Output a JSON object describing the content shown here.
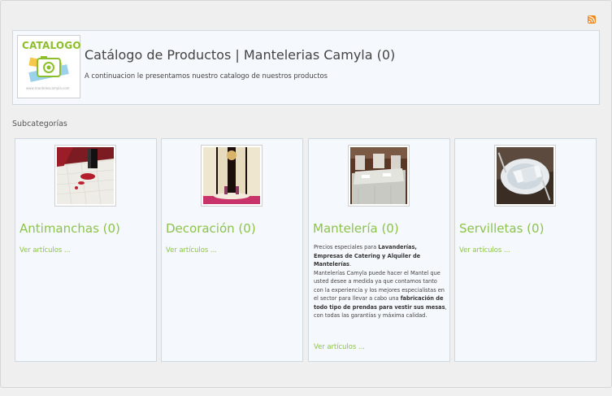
{
  "header": {
    "logo_text": "CATALOGO",
    "logo_url": "www.mantelescamyla.com",
    "title": "Catálogo de Productos | Mantelerias Camyla (0)",
    "subtitle": "A continuacion le presentamos nuestro catalogo de nuestros productos"
  },
  "rss_icon": "rss-feed-icon",
  "subcategories_label": "Subcategorías",
  "categories": [
    {
      "name": "Antimanchas (0)",
      "link": "Ver artículos ..."
    },
    {
      "name": "Decoración (0)",
      "link": "Ver artículos ..."
    },
    {
      "name": "Mantelería (0)",
      "link": "Ver artículos ...",
      "desc": {
        "p1_a": "Precios especiales para ",
        "p1_b": "Lavanderías, Empresas de Catering y Alquiler de Mantelerías",
        "p1_c": ".",
        "p2_a": "Mantelerías Camyla puede hacer el Mantel que usted desee a medida ya que contamos tanto con la experiencia y los mejores especialistas en el sector para llevar a cabo una ",
        "p2_b": "fabricación de todo tipo de prendas para vestir sus mesas",
        "p2_c": ", con todas las garantías y máxima calidad."
      }
    },
    {
      "name": "Servilletas (0)",
      "link": "Ver artículos ..."
    }
  ],
  "colors": {
    "accent": "#8dc34b",
    "header_bg": "#f5f8fc",
    "border": "#cfd7df",
    "rss": "#f28a1c"
  }
}
